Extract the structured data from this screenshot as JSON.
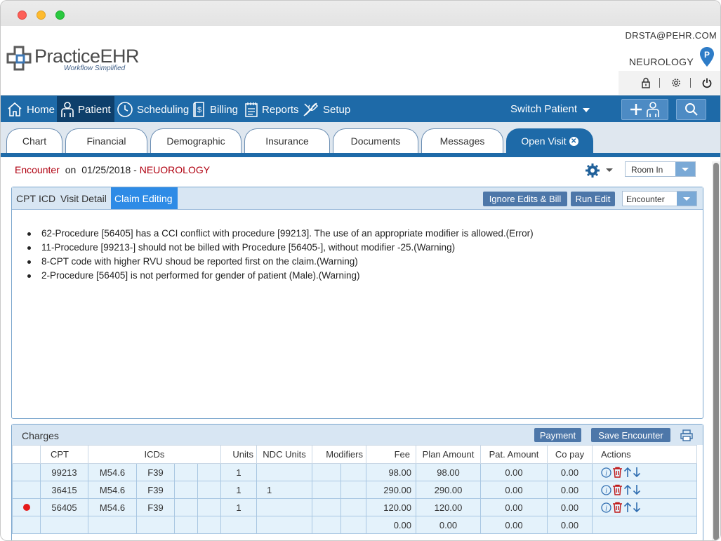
{
  "header": {
    "logo_main": "PracticeEHR",
    "logo_sub": "Workflow Simplified",
    "user_email": "DRSTA@PEHR.COM",
    "facility": "NEUROLOGY",
    "facility_badge": "P"
  },
  "nav": {
    "items": [
      {
        "label": "Home",
        "icon": "home-icon"
      },
      {
        "label": "Patient",
        "icon": "patient-icon"
      },
      {
        "label": "Scheduling",
        "icon": "clock-icon"
      },
      {
        "label": "Billing",
        "icon": "billing-icon"
      },
      {
        "label": "Reports",
        "icon": "reports-icon"
      },
      {
        "label": "Setup",
        "icon": "tools-icon"
      }
    ],
    "switch_patient": "Switch Patient"
  },
  "tabs": [
    "Chart",
    "Financial",
    "Demographic",
    "Insurance",
    "Documents",
    "Messages",
    "Open Visit"
  ],
  "encounter": {
    "label": "Encounter",
    "on": "on",
    "date": "01/25/2018 -",
    "specialty": "NEUOROLOGY",
    "room": "Room In"
  },
  "panel": {
    "tabs": [
      "CPT",
      "ICD",
      "Visit Detail",
      "Claim Editing"
    ],
    "ignore_btn": "Ignore Edits & Bill",
    "run_btn": "Run Edit",
    "select": "Encounter",
    "edits": [
      "62-Procedure [56405] has a CCI conflict with procedure [99213]. The use of an appropriate modifier is allowed.(Error)",
      "11-Procedure [99213-] should not be billed with Procedure [56405-], without modifier -25.(Warning)",
      "8-CPT code with higher RVU shoud be reported first on the claim.(Warning)",
      "2-Procedure [56405] is not performed for gender of patient (Male).(Warning)"
    ]
  },
  "charges": {
    "title": "Charges",
    "payment_btn": "Payment",
    "save_btn": "Save Encounter",
    "columns": {
      "cpt": "CPT",
      "icds": "ICDs",
      "units": "Units",
      "ndc": "NDC Units",
      "modifiers": "Modifiers",
      "fee": "Fee",
      "plan": "Plan Amount",
      "pat": "Pat. Amount",
      "copay": "Co pay",
      "actions": "Actions"
    },
    "rows": [
      {
        "cpt": "99213",
        "icd1": "M54.6",
        "icd2": "F39",
        "units": "1",
        "ndc": "",
        "fee": "98.00",
        "plan": "98.00",
        "pat": "0.00",
        "copay": "0.00"
      },
      {
        "cpt": "36415",
        "icd1": "M54.6",
        "icd2": "F39",
        "units": "1",
        "ndc": "1",
        "fee": "290.00",
        "plan": "290.00",
        "pat": "0.00",
        "copay": "0.00"
      },
      {
        "cpt": "56405",
        "icd1": "M54.6",
        "icd2": "F39",
        "units": "1",
        "ndc": "",
        "fee": "120.00",
        "plan": "120.00",
        "pat": "0.00",
        "copay": "0.00"
      }
    ],
    "totals": {
      "fee": "0.00",
      "plan": "0.00",
      "pat": "0.00",
      "copay": "0.00"
    }
  }
}
